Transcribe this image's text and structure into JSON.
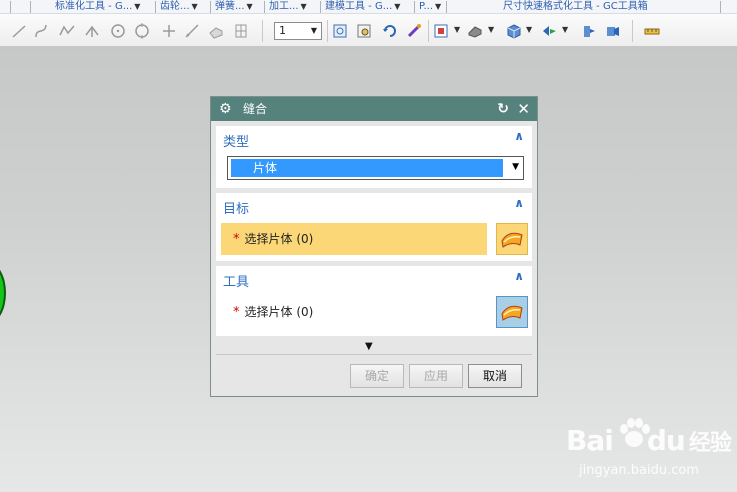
{
  "menubar": {
    "items": [
      {
        "label": "标准化工具 - G...",
        "has_caret": true
      },
      {
        "label": "齿轮...",
        "has_caret": true
      },
      {
        "label": "弹簧...",
        "has_caret": true
      },
      {
        "label": "加工...",
        "has_caret": true
      },
      {
        "label": "建模工具 - G...",
        "has_caret": true
      },
      {
        "label": "P...",
        "has_caret": true
      },
      {
        "label": "尺寸快速格式化工具 - GC工具箱",
        "has_caret": false
      }
    ],
    "text_color": "#2f5fb0"
  },
  "toolbar": {
    "grayed_tools": [
      "line-icon",
      "arc-icon",
      "studio-spline-icon",
      "rays-icon",
      "circle-icon",
      "circle-center-icon",
      "point-icon",
      "straight-line-icon",
      "sheet-icon",
      "grid-icon"
    ],
    "layer_value": "1",
    "color_tools": [
      "fit-view-icon",
      "zoom-icon",
      "rotate-icon",
      "paint-icon",
      "render-style-icon",
      "shading-icon",
      "cube-icon",
      "orient-view-icon",
      "section-icon",
      "perspective-icon",
      "measure-icon"
    ]
  },
  "dialog": {
    "title": "缝合",
    "reset_icon": "reset-icon",
    "close_icon": "close-icon",
    "type_group": {
      "header": "类型",
      "selected": "片体",
      "collapse_icon": "chevron-up-icon"
    },
    "target_group": {
      "header": "目标",
      "required_mark": "*",
      "select_label": "选择片体 (0)",
      "collapse_icon": "chevron-up-icon"
    },
    "tool_group": {
      "header": "工具",
      "required_mark": "*",
      "select_label": "选择片体 (0)",
      "collapse_icon": "chevron-up-icon"
    },
    "more_icon": "chevron-down-icon",
    "buttons": {
      "ok": "确定",
      "apply": "应用",
      "cancel": "取消"
    },
    "colors": {
      "title_bar": "#55827c",
      "header_text": "#2e6fc2",
      "active_row": "#fbd777",
      "selection_blue": "#3399ff"
    }
  },
  "watermark": {
    "brand": "Bai",
    "brand_suffix": "du",
    "product": "经验",
    "url": "jingyan.baidu.com"
  }
}
